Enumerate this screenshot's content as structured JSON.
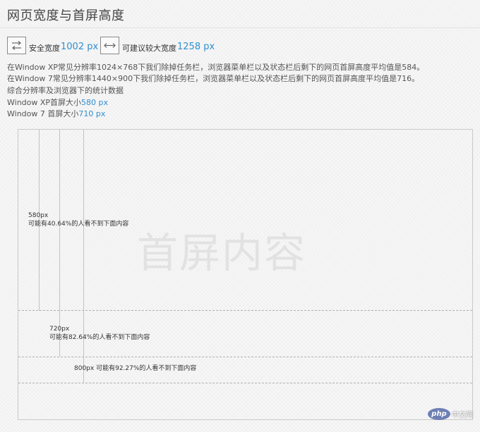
{
  "title": "网页宽度与首屏高度",
  "specs": {
    "safe_label": "安全宽度",
    "safe_value": "1002 px",
    "suggest_label": "可建议较大宽度",
    "suggest_value": "1258 px"
  },
  "lines": {
    "xp": "在Window XP常见分辨率1024×768下我们除掉任务栏，浏览器菜单栏以及状态栏后剩下的网页首屏高度平均值是584。",
    "win7": "在Window 7常见分辨率1440×900下我们除掉任务栏，浏览器菜单栏以及状态栏后剩下的网页首屏高度平均值是716。",
    "stats": "综合分辨率及浏览器下的统计数据",
    "xp_label": "Window XP首屏大小",
    "xp_value": "580 px",
    "w7_label": "Window 7 首屏大小",
    "w7_value": "710 px"
  },
  "diagram": {
    "watermark": "首屏内容",
    "m580": {
      "px": "580px",
      "desc": "可能有40.64%的人看不到下面内容"
    },
    "m720": {
      "px": "720px",
      "desc": "可能有82.64%的人看不到下面内容"
    },
    "m800": {
      "px": "800px",
      "desc": "可能有92.27%的人看不到下面内容"
    }
  },
  "logo": {
    "mark": "php",
    "text": "中文网"
  },
  "icons": {
    "safe": "swap-arrows-icon",
    "suggest": "horizontal-expand-icon"
  }
}
